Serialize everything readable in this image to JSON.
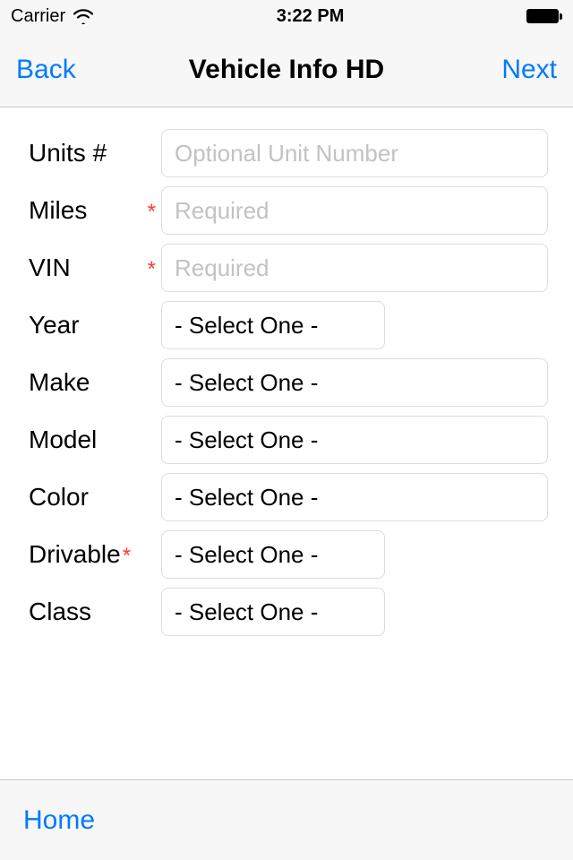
{
  "status": {
    "carrier": "Carrier",
    "time": "3:22 PM"
  },
  "nav": {
    "back": "Back",
    "title": "Vehicle Info HD",
    "next": "Next"
  },
  "form": {
    "units": {
      "label": "Units #",
      "required": false,
      "placeholder": "Optional Unit Number"
    },
    "miles": {
      "label": "Miles",
      "required": true,
      "placeholder": "Required"
    },
    "vin": {
      "label": "VIN",
      "required": true,
      "placeholder": "Required"
    },
    "year": {
      "label": "Year",
      "required": false,
      "value": "- Select One -",
      "width": "narrow"
    },
    "make": {
      "label": "Make",
      "required": false,
      "value": "- Select One -",
      "width": "wide"
    },
    "model": {
      "label": "Model",
      "required": false,
      "value": "- Select One -",
      "width": "wide"
    },
    "color": {
      "label": "Color",
      "required": false,
      "value": "- Select One -",
      "width": "wide"
    },
    "drivable": {
      "label": "Drivable",
      "required": true,
      "value": "- Select One -",
      "width": "narrow"
    },
    "class": {
      "label": "Class",
      "required": false,
      "value": "- Select One -",
      "width": "narrow"
    }
  },
  "required_marker": "*",
  "bottom": {
    "home": "Home"
  },
  "colors": {
    "accent": "#007aff",
    "required": "#ff3b30"
  }
}
